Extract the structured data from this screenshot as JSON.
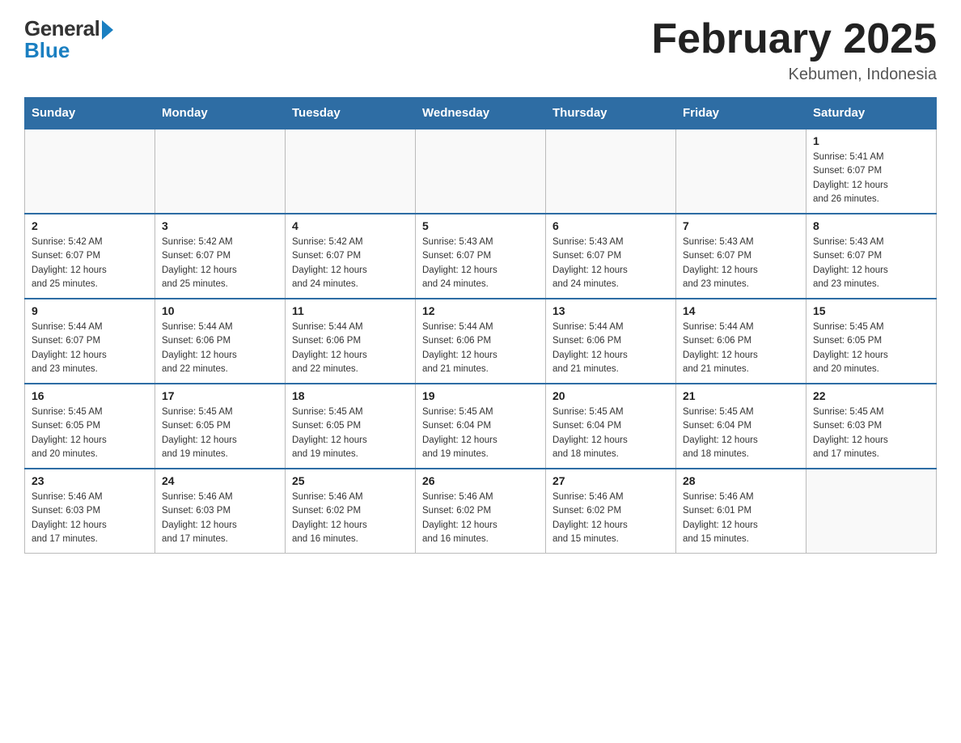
{
  "logo": {
    "general": "General",
    "blue": "Blue"
  },
  "title": {
    "month_year": "February 2025",
    "location": "Kebumen, Indonesia"
  },
  "weekdays": [
    "Sunday",
    "Monday",
    "Tuesday",
    "Wednesday",
    "Thursday",
    "Friday",
    "Saturday"
  ],
  "weeks": [
    [
      {
        "day": "",
        "info": ""
      },
      {
        "day": "",
        "info": ""
      },
      {
        "day": "",
        "info": ""
      },
      {
        "day": "",
        "info": ""
      },
      {
        "day": "",
        "info": ""
      },
      {
        "day": "",
        "info": ""
      },
      {
        "day": "1",
        "info": "Sunrise: 5:41 AM\nSunset: 6:07 PM\nDaylight: 12 hours\nand 26 minutes."
      }
    ],
    [
      {
        "day": "2",
        "info": "Sunrise: 5:42 AM\nSunset: 6:07 PM\nDaylight: 12 hours\nand 25 minutes."
      },
      {
        "day": "3",
        "info": "Sunrise: 5:42 AM\nSunset: 6:07 PM\nDaylight: 12 hours\nand 25 minutes."
      },
      {
        "day": "4",
        "info": "Sunrise: 5:42 AM\nSunset: 6:07 PM\nDaylight: 12 hours\nand 24 minutes."
      },
      {
        "day": "5",
        "info": "Sunrise: 5:43 AM\nSunset: 6:07 PM\nDaylight: 12 hours\nand 24 minutes."
      },
      {
        "day": "6",
        "info": "Sunrise: 5:43 AM\nSunset: 6:07 PM\nDaylight: 12 hours\nand 24 minutes."
      },
      {
        "day": "7",
        "info": "Sunrise: 5:43 AM\nSunset: 6:07 PM\nDaylight: 12 hours\nand 23 minutes."
      },
      {
        "day": "8",
        "info": "Sunrise: 5:43 AM\nSunset: 6:07 PM\nDaylight: 12 hours\nand 23 minutes."
      }
    ],
    [
      {
        "day": "9",
        "info": "Sunrise: 5:44 AM\nSunset: 6:07 PM\nDaylight: 12 hours\nand 23 minutes."
      },
      {
        "day": "10",
        "info": "Sunrise: 5:44 AM\nSunset: 6:06 PM\nDaylight: 12 hours\nand 22 minutes."
      },
      {
        "day": "11",
        "info": "Sunrise: 5:44 AM\nSunset: 6:06 PM\nDaylight: 12 hours\nand 22 minutes."
      },
      {
        "day": "12",
        "info": "Sunrise: 5:44 AM\nSunset: 6:06 PM\nDaylight: 12 hours\nand 21 minutes."
      },
      {
        "day": "13",
        "info": "Sunrise: 5:44 AM\nSunset: 6:06 PM\nDaylight: 12 hours\nand 21 minutes."
      },
      {
        "day": "14",
        "info": "Sunrise: 5:44 AM\nSunset: 6:06 PM\nDaylight: 12 hours\nand 21 minutes."
      },
      {
        "day": "15",
        "info": "Sunrise: 5:45 AM\nSunset: 6:05 PM\nDaylight: 12 hours\nand 20 minutes."
      }
    ],
    [
      {
        "day": "16",
        "info": "Sunrise: 5:45 AM\nSunset: 6:05 PM\nDaylight: 12 hours\nand 20 minutes."
      },
      {
        "day": "17",
        "info": "Sunrise: 5:45 AM\nSunset: 6:05 PM\nDaylight: 12 hours\nand 19 minutes."
      },
      {
        "day": "18",
        "info": "Sunrise: 5:45 AM\nSunset: 6:05 PM\nDaylight: 12 hours\nand 19 minutes."
      },
      {
        "day": "19",
        "info": "Sunrise: 5:45 AM\nSunset: 6:04 PM\nDaylight: 12 hours\nand 19 minutes."
      },
      {
        "day": "20",
        "info": "Sunrise: 5:45 AM\nSunset: 6:04 PM\nDaylight: 12 hours\nand 18 minutes."
      },
      {
        "day": "21",
        "info": "Sunrise: 5:45 AM\nSunset: 6:04 PM\nDaylight: 12 hours\nand 18 minutes."
      },
      {
        "day": "22",
        "info": "Sunrise: 5:45 AM\nSunset: 6:03 PM\nDaylight: 12 hours\nand 17 minutes."
      }
    ],
    [
      {
        "day": "23",
        "info": "Sunrise: 5:46 AM\nSunset: 6:03 PM\nDaylight: 12 hours\nand 17 minutes."
      },
      {
        "day": "24",
        "info": "Sunrise: 5:46 AM\nSunset: 6:03 PM\nDaylight: 12 hours\nand 17 minutes."
      },
      {
        "day": "25",
        "info": "Sunrise: 5:46 AM\nSunset: 6:02 PM\nDaylight: 12 hours\nand 16 minutes."
      },
      {
        "day": "26",
        "info": "Sunrise: 5:46 AM\nSunset: 6:02 PM\nDaylight: 12 hours\nand 16 minutes."
      },
      {
        "day": "27",
        "info": "Sunrise: 5:46 AM\nSunset: 6:02 PM\nDaylight: 12 hours\nand 15 minutes."
      },
      {
        "day": "28",
        "info": "Sunrise: 5:46 AM\nSunset: 6:01 PM\nDaylight: 12 hours\nand 15 minutes."
      },
      {
        "day": "",
        "info": ""
      }
    ]
  ]
}
